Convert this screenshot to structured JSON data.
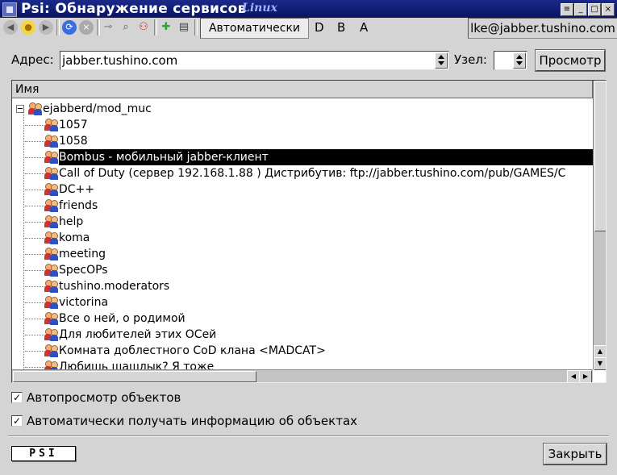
{
  "window": {
    "title": "Psi: Обнаружение сервисов",
    "brand": "Linux"
  },
  "toolbar": {
    "auto_label": "Автоматически",
    "letters": [
      "D",
      "B",
      "A"
    ],
    "account": "lke@jabber.tushino.com"
  },
  "form": {
    "address_label": "Адрес:",
    "address_value": "jabber.tushino.com",
    "node_label": "Узел:",
    "node_value": "",
    "browse_button": "Просмотр"
  },
  "list": {
    "column_header": "Имя",
    "root": "ejabberd/mod_muc",
    "items": [
      "1057",
      "1058",
      "Bombus - мобильный jabber-клиент",
      "Call of Duty (сервер 192.168.1.88 ) Дистрибутив: ftp://jabber.tushino.com/pub/GAMES/C",
      "DC++",
      "friends",
      "help",
      "koma",
      "meeting",
      "SpecOPs",
      "tushino.moderators",
      "victorina",
      "Все о ней, о родимой",
      "Для любителей этих ОСей",
      "Комната доблестного CoD клана <MADCAT>",
      "Любишь шашлык? Я тоже"
    ],
    "selected_index": 2
  },
  "options": {
    "auto_browse": "Автопросмотр объектов",
    "auto_info": "Автоматически получать информацию об объектах",
    "auto_browse_checked": true,
    "auto_info_checked": true
  },
  "footer": {
    "logo": "PSI",
    "close_button": "Закрыть"
  },
  "colors": {
    "titlebar": "#0a1460",
    "selection": "#000000",
    "window_bg": "#d4d4d4"
  }
}
